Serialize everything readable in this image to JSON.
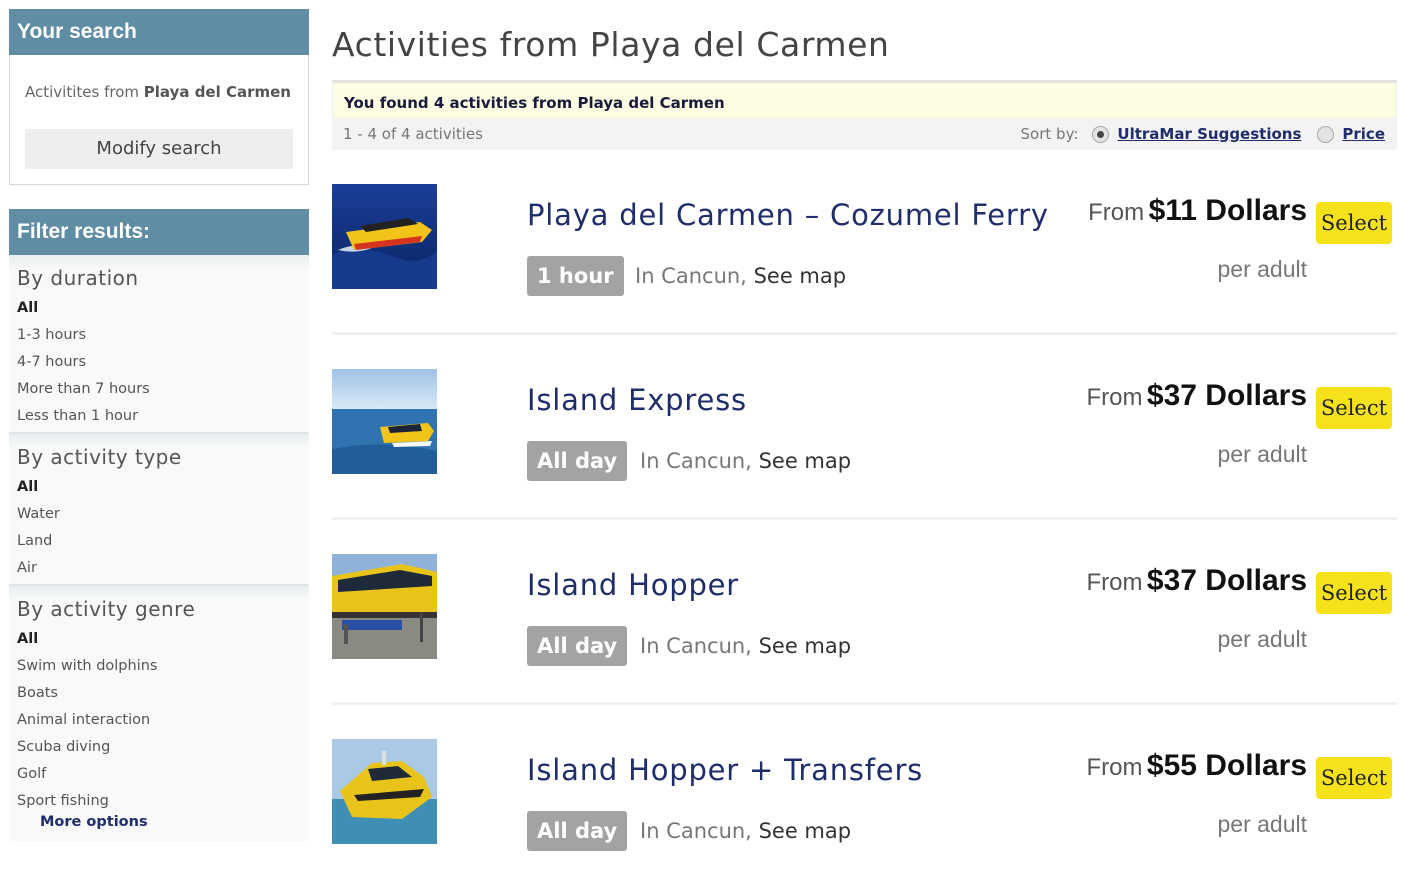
{
  "sidebar": {
    "search_title": "Your search",
    "search_prefix": "Activitites from",
    "search_place": "Playa del Carmen",
    "modify_label": "Modify search",
    "filter_title": "Filter results:",
    "groups": [
      {
        "title": "By duration",
        "options": [
          "All",
          "1-3 hours",
          "4-7 hours",
          "More than 7 hours",
          "Less than 1 hour"
        ]
      },
      {
        "title": "By activity type",
        "options": [
          "All",
          "Water",
          "Land",
          "Air"
        ]
      },
      {
        "title": "By activity genre",
        "options": [
          "All",
          "Swim with dolphins",
          "Boats",
          "Animal interaction",
          "Scuba diving",
          "Golf",
          "Sport fishing"
        ]
      }
    ],
    "more_options": "More options"
  },
  "main": {
    "title": "Activities from Playa del Carmen",
    "found_text": "You found 4 activities from Playa del Carmen",
    "range_text": "1 - 4 of 4 activities",
    "sort_label": "Sort by:",
    "sort_options": [
      {
        "label": "UltraMar Suggestions",
        "checked": true
      },
      {
        "label": "Price",
        "checked": false
      }
    ],
    "activities": [
      {
        "title": "Playa del Carmen – Cozumel Ferry",
        "duration": "1 hour",
        "location": "In Cancun,",
        "map_label": "See map",
        "from": "From",
        "price": "$11 Dollars",
        "per": "per adult",
        "select": "Select"
      },
      {
        "title": "Island Express",
        "duration": "All day",
        "location": "In Cancun,",
        "map_label": "See map",
        "from": "From",
        "price": "$37 Dollars",
        "per": "per adult",
        "select": "Select"
      },
      {
        "title": "Island Hopper",
        "duration": "All day",
        "location": "In Cancun,",
        "map_label": "See map",
        "from": "From",
        "price": "$37 Dollars",
        "per": "per adult",
        "select": "Select"
      },
      {
        "title": "Island Hopper + Transfers",
        "duration": "All day",
        "location": "In Cancun,",
        "map_label": "See map",
        "from": "From",
        "price": "$55 Dollars",
        "per": "per adult",
        "select": "Select"
      }
    ]
  },
  "colors": {
    "panel_header": "#5f8ea4",
    "title_link": "#1f2e6b",
    "select_button": "#f5e21b",
    "found_bar": "#fdfde3",
    "duration_badge": "#a3a3a3"
  }
}
